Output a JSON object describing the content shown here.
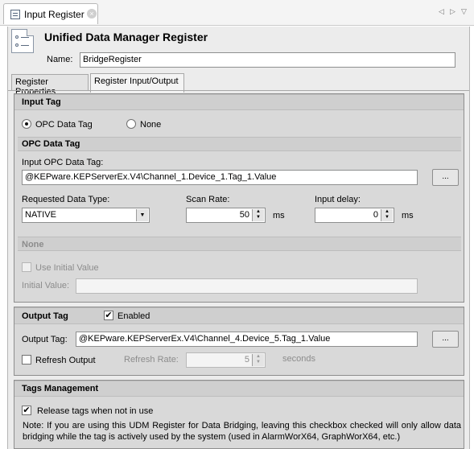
{
  "editor_tab": {
    "title": "Input Register",
    "close": "×"
  },
  "nav": {
    "left": "◁",
    "right": "▷",
    "menu": "▽"
  },
  "header": {
    "title": "Unified Data Manager Register",
    "name_label": "Name:",
    "name_value": "BridgeRegister"
  },
  "tabs": [
    {
      "label": "Register Properties"
    },
    {
      "label": "Register Input/Output"
    }
  ],
  "input_tag": {
    "title": "Input Tag",
    "opt_opc": "OPC Data Tag",
    "opt_none": "None",
    "opc_section": "OPC Data Tag",
    "opc_tag_label": "Input OPC Data Tag:",
    "opc_tag_value": "@KEPware.KEPServerEx.V4\\Channel_1.Device_1.Tag_1.Value",
    "browse": "...",
    "data_type_label": "Requested Data Type:",
    "data_type_value": "NATIVE",
    "scan_rate_label": "Scan Rate:",
    "scan_rate_value": "50",
    "scan_rate_unit": "ms",
    "delay_label": "Input delay:",
    "delay_value": "0",
    "delay_unit": "ms",
    "none_section": "None",
    "use_initial": "Use Initial Value",
    "initial_label": "Initial Value:"
  },
  "output_tag": {
    "title": "Output Tag",
    "enabled_label": "Enabled",
    "tag_label": "Output Tag:",
    "tag_value": "@KEPware.KEPServerEx.V4\\Channel_4.Device_5.Tag_1.Value",
    "browse": "...",
    "refresh_output": "Refresh Output",
    "refresh_rate_label": "Refresh Rate:",
    "refresh_rate_value": "5",
    "refresh_unit": "seconds"
  },
  "tags_mgmt": {
    "title": "Tags Management",
    "release_label": "Release tags when not in use",
    "note": "Note: If you are using this UDM Register for Data Bridging, leaving this checkbox checked will only allow data bridging while the tag is actively used by the system (used in AlarmWorX64, GraphWorX64, etc.)"
  },
  "checkmark": "✔",
  "arrow_down": "▼",
  "spin_arrows": "▲▼"
}
